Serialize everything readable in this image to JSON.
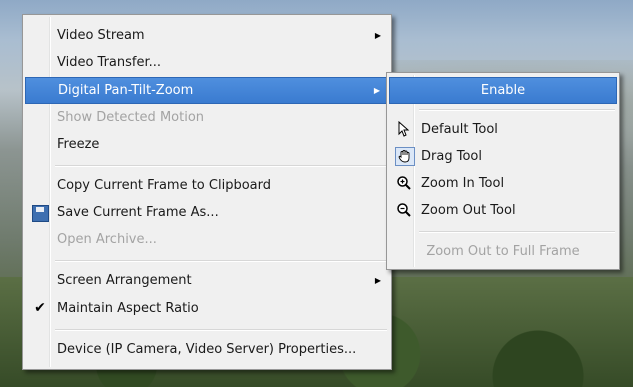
{
  "main_menu": {
    "items": [
      {
        "label": "Video Stream",
        "submenu": true,
        "disabled": false
      },
      {
        "label": "Video Transfer...",
        "submenu": false,
        "disabled": false
      },
      {
        "label": "Digital Pan-Tilt-Zoom",
        "submenu": true,
        "disabled": false,
        "highlighted": true
      },
      {
        "label": "Show Detected Motion",
        "submenu": false,
        "disabled": true
      },
      {
        "label": "Freeze",
        "submenu": false,
        "disabled": false
      },
      {
        "label": "Copy Current Frame to Clipboard",
        "submenu": false,
        "disabled": false
      },
      {
        "label": "Save Current Frame As...",
        "submenu": false,
        "disabled": false,
        "icon": "save-icon"
      },
      {
        "label": "Open Archive...",
        "submenu": false,
        "disabled": true
      },
      {
        "label": "Screen Arrangement",
        "submenu": true,
        "disabled": false
      },
      {
        "label": "Maintain Aspect Ratio",
        "submenu": false,
        "disabled": false,
        "checked": true,
        "icon": "checkmark-icon"
      },
      {
        "label": "Device (IP Camera, Video Server) Properties...",
        "submenu": false,
        "disabled": false
      }
    ]
  },
  "sub_menu": {
    "items": [
      {
        "label": "Enable",
        "highlighted": true
      },
      {
        "label": "Default Tool",
        "icon": "arrow-cursor-icon"
      },
      {
        "label": "Drag Tool",
        "icon": "hand-cursor-icon"
      },
      {
        "label": "Zoom In Tool",
        "icon": "zoom-in-icon"
      },
      {
        "label": "Zoom Out Tool",
        "icon": "zoom-out-icon"
      },
      {
        "label": "Zoom Out to Full Frame",
        "disabled": true
      }
    ]
  },
  "colors": {
    "menu_bg": "#f0f0f0",
    "highlight": "#3a7bd0",
    "disabled_text": "#a3a3a3"
  }
}
